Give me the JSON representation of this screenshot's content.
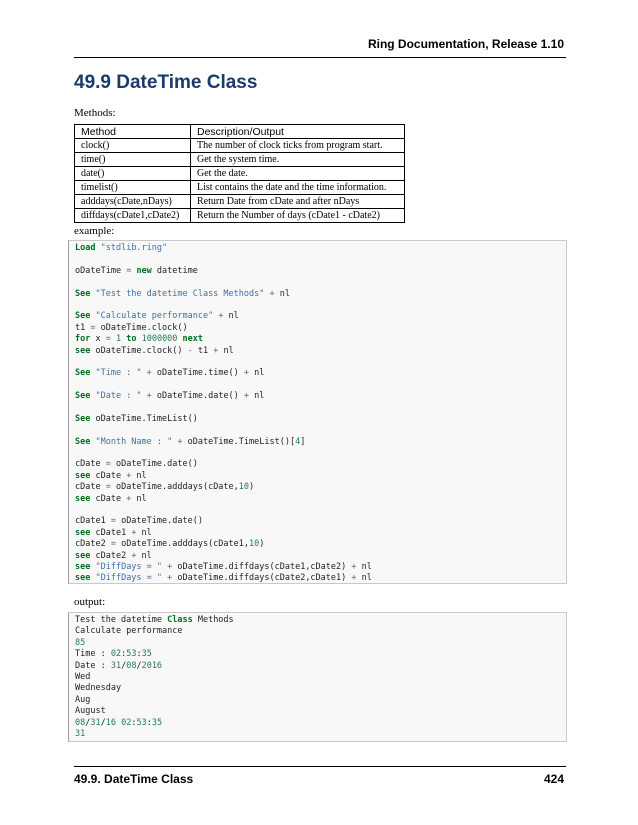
{
  "header": {
    "title": "Ring Documentation, Release 1.10"
  },
  "section": {
    "title": "49.9 DateTime Class"
  },
  "methods_label": "Methods:",
  "table": {
    "headers": [
      "Method",
      "Description/Output"
    ],
    "rows": [
      [
        "clock()",
        "The number of clock ticks from program start."
      ],
      [
        "time()",
        "Get the system time."
      ],
      [
        "date()",
        "Get the date."
      ],
      [
        "timelist()",
        "List contains the date and the time information."
      ],
      [
        "adddays(cDate,nDays)",
        "Return Date from cDate and after nDays"
      ],
      [
        "diffdays(cDate1,cDate2)",
        "Return the Number of days (cDate1 - cDate2)"
      ]
    ]
  },
  "example_label": "example:",
  "example_code": [
    "Load \"stdlib.ring\"",
    "",
    "oDateTime = new datetime",
    "",
    "See \"Test the datetime Class Methods\" + nl",
    "",
    "See \"Calculate performance\" + nl",
    "t1 = oDateTime.clock()",
    "for x = 1 to 1000000 next",
    "see oDateTime.clock() - t1 + nl",
    "",
    "See \"Time : \" + oDateTime.time() + nl",
    "",
    "See \"Date : \" + oDateTime.date() + nl",
    "",
    "See oDateTime.TimeList()",
    "",
    "See \"Month Name : \" + oDateTime.TimeList()[4]",
    "",
    "cDate = oDateTime.date()",
    "see cDate + nl",
    "cDate = oDateTime.adddays(cDate,10)",
    "see cDate + nl",
    "",
    "cDate1 = oDateTime.date()",
    "see cDate1 + nl",
    "cDate2 = oDateTime.adddays(cDate1,10)",
    "see cDate2 + nl",
    "see \"DiffDays = \" + oDateTime.diffdays(cDate1,cDate2) + nl",
    "see \"DiffDays = \" + oDateTime.diffdays(cDate2,cDate1) + nl"
  ],
  "output_label": "output:",
  "output_code": [
    "Test the datetime Class Methods",
    "Calculate performance",
    "85",
    "Time : 02:53:35",
    "Date : 31/08/2016",
    "Wed",
    "Wednesday",
    "Aug",
    "August",
    "08/31/16 02:53:35",
    "31"
  ],
  "footer": {
    "section": "49.9. DateTime Class",
    "page": "424"
  }
}
